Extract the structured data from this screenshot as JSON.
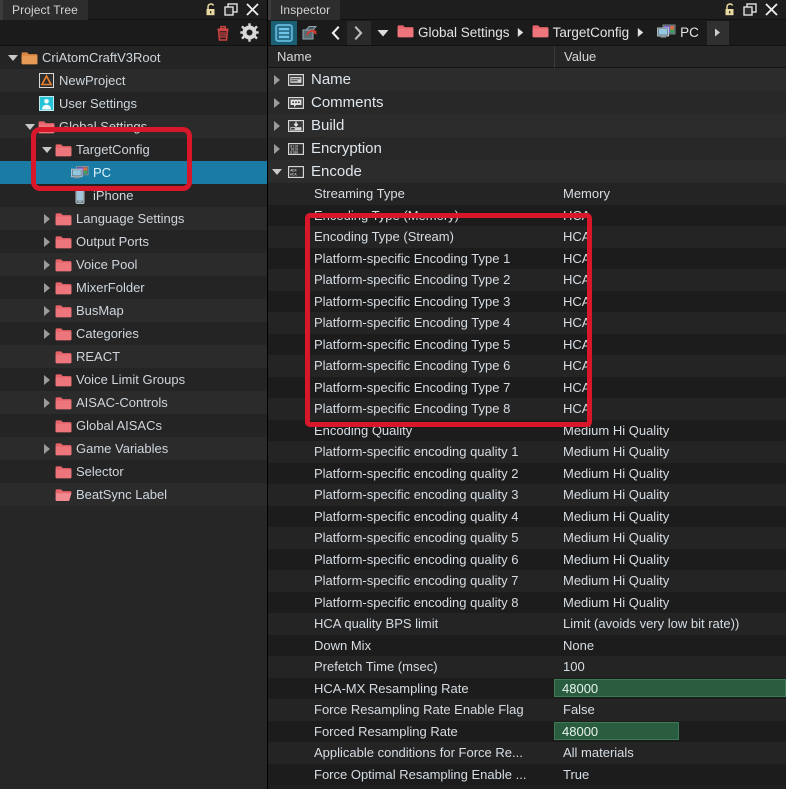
{
  "project_panel": {
    "title": "Project Tree",
    "window_buttons": [
      {
        "name": "unlock-icon",
        "label": "Unlock"
      },
      {
        "name": "restore-icon",
        "label": "Restore"
      },
      {
        "name": "close-icon",
        "label": "Close"
      }
    ],
    "toolbar": [
      {
        "name": "delete-icon",
        "label": "Delete"
      },
      {
        "name": "gear-icon",
        "label": "Settings"
      }
    ],
    "tree": [
      {
        "label": "CriAtomCraftV3Root",
        "depth": 0,
        "caret": "down",
        "icon": "folder-orange-icon",
        "selected": false
      },
      {
        "label": "NewProject",
        "depth": 1,
        "caret": "none",
        "icon": "project-icon",
        "selected": false
      },
      {
        "label": "User Settings",
        "depth": 1,
        "caret": "none",
        "icon": "user-icon",
        "selected": false
      },
      {
        "label": "Global Settings",
        "depth": 1,
        "caret": "down",
        "icon": "folder-red-icon",
        "selected": false
      },
      {
        "label": "TargetConfig",
        "depth": 2,
        "caret": "down",
        "icon": "folder-red-icon",
        "selected": false
      },
      {
        "label": "PC",
        "depth": 3,
        "caret": "none",
        "icon": "pc-icon",
        "selected": true
      },
      {
        "label": "iPhone",
        "depth": 3,
        "caret": "none",
        "icon": "iphone-icon",
        "selected": false
      },
      {
        "label": "Language Settings",
        "depth": 2,
        "caret": "right",
        "icon": "folder-red-icon",
        "selected": false
      },
      {
        "label": "Output Ports",
        "depth": 2,
        "caret": "right",
        "icon": "folder-red-icon",
        "selected": false
      },
      {
        "label": "Voice Pool",
        "depth": 2,
        "caret": "right",
        "icon": "folder-red-icon",
        "selected": false
      },
      {
        "label": "MixerFolder",
        "depth": 2,
        "caret": "right",
        "icon": "folder-red-icon",
        "selected": false
      },
      {
        "label": "BusMap",
        "depth": 2,
        "caret": "right",
        "icon": "folder-red-icon",
        "selected": false
      },
      {
        "label": "Categories",
        "depth": 2,
        "caret": "right",
        "icon": "folder-red-icon",
        "selected": false
      },
      {
        "label": "REACT",
        "depth": 2,
        "caret": "none",
        "icon": "folder-red-icon",
        "selected": false
      },
      {
        "label": "Voice Limit Groups",
        "depth": 2,
        "caret": "right",
        "icon": "folder-red-icon",
        "selected": false
      },
      {
        "label": "AISAC-Controls",
        "depth": 2,
        "caret": "right",
        "icon": "folder-red-icon",
        "selected": false
      },
      {
        "label": "Global AISACs",
        "depth": 2,
        "caret": "none",
        "icon": "folder-red-icon",
        "selected": false
      },
      {
        "label": "Game Variables",
        "depth": 2,
        "caret": "right",
        "icon": "folder-red-icon",
        "selected": false
      },
      {
        "label": "Selector",
        "depth": 2,
        "caret": "none",
        "icon": "folder-red-icon",
        "selected": false
      },
      {
        "label": "BeatSync Label",
        "depth": 2,
        "caret": "none",
        "icon": "folder-red-open-icon",
        "selected": false
      }
    ]
  },
  "inspector_panel": {
    "title": "Inspector",
    "window_buttons": [
      {
        "name": "unlock-icon",
        "label": "Unlock"
      },
      {
        "name": "restore-icon",
        "label": "Restore"
      },
      {
        "name": "close-icon",
        "label": "Close"
      }
    ],
    "toolbar": {
      "list_view_label": "List View",
      "back_to_object_label": "Back To Object",
      "prev_label": "Previous",
      "next_label": "Next",
      "history_label": "History"
    },
    "breadcrumb": [
      {
        "label": "Global Settings",
        "icon": "folder-red-icon"
      },
      {
        "label": "TargetConfig",
        "icon": "folder-red-icon"
      },
      {
        "label": "PC",
        "icon": "pc-icon"
      }
    ],
    "columns": {
      "name": "Name",
      "value": "Value"
    },
    "rows": [
      {
        "type": "group",
        "label": "Name",
        "icon": "name-icon",
        "caret": "right"
      },
      {
        "type": "group",
        "label": "Comments",
        "icon": "comments-icon",
        "caret": "right"
      },
      {
        "type": "group",
        "label": "Build",
        "icon": "build-icon",
        "caret": "right"
      },
      {
        "type": "group",
        "label": "Encryption",
        "icon": "encryption-icon",
        "caret": "right"
      },
      {
        "type": "group",
        "label": "Encode",
        "icon": "encode-icon",
        "caret": "down"
      },
      {
        "type": "prop",
        "label": "Streaming Type",
        "value": "Memory",
        "style": "plain"
      },
      {
        "type": "prop",
        "label": "Encoding Type (Memory)",
        "value": "HCA",
        "style": "plain"
      },
      {
        "type": "prop",
        "label": "Encoding Type (Stream)",
        "value": "HCA",
        "style": "plain"
      },
      {
        "type": "prop",
        "label": "Platform-specific Encoding Type 1",
        "value": "HCA",
        "style": "plain"
      },
      {
        "type": "prop",
        "label": "Platform-specific Encoding Type 2",
        "value": "HCA",
        "style": "plain"
      },
      {
        "type": "prop",
        "label": "Platform-specific Encoding Type 3",
        "value": "HCA",
        "style": "plain"
      },
      {
        "type": "prop",
        "label": "Platform-specific Encoding Type 4",
        "value": "HCA",
        "style": "plain"
      },
      {
        "type": "prop",
        "label": "Platform-specific Encoding Type 5",
        "value": "HCA",
        "style": "plain"
      },
      {
        "type": "prop",
        "label": "Platform-specific Encoding Type 6",
        "value": "HCA",
        "style": "plain"
      },
      {
        "type": "prop",
        "label": "Platform-specific Encoding Type 7",
        "value": "HCA",
        "style": "plain"
      },
      {
        "type": "prop",
        "label": "Platform-specific Encoding Type 8",
        "value": "HCA",
        "style": "plain"
      },
      {
        "type": "prop",
        "label": "Encoding Quality",
        "value": "Medium Hi Quality",
        "style": "plain"
      },
      {
        "type": "prop",
        "label": "Platform-specific encoding quality 1",
        "value": "Medium Hi Quality",
        "style": "plain"
      },
      {
        "type": "prop",
        "label": "Platform-specific encoding quality 2",
        "value": "Medium Hi Quality",
        "style": "plain"
      },
      {
        "type": "prop",
        "label": "Platform-specific encoding quality 3",
        "value": "Medium Hi Quality",
        "style": "plain"
      },
      {
        "type": "prop",
        "label": "Platform-specific encoding quality 4",
        "value": "Medium Hi Quality",
        "style": "plain"
      },
      {
        "type": "prop",
        "label": "Platform-specific encoding quality 5",
        "value": "Medium Hi Quality",
        "style": "plain"
      },
      {
        "type": "prop",
        "label": "Platform-specific encoding quality 6",
        "value": "Medium Hi Quality",
        "style": "plain"
      },
      {
        "type": "prop",
        "label": "Platform-specific encoding quality 7",
        "value": "Medium Hi Quality",
        "style": "plain"
      },
      {
        "type": "prop",
        "label": "Platform-specific encoding quality 8",
        "value": "Medium Hi Quality",
        "style": "plain"
      },
      {
        "type": "prop",
        "label": "HCA quality BPS limit",
        "value": "Limit (avoids very low bit rate))",
        "style": "plain"
      },
      {
        "type": "prop",
        "label": "Down Mix",
        "value": "None",
        "style": "plain"
      },
      {
        "type": "prop",
        "label": "Prefetch Time (msec)",
        "value": "100",
        "style": "plain"
      },
      {
        "type": "prop",
        "label": "HCA-MX Resampling Rate",
        "value": "48000",
        "style": "field-full"
      },
      {
        "type": "prop",
        "label": "Force Resampling Rate Enable Flag",
        "value": "False",
        "style": "plain"
      },
      {
        "type": "prop",
        "label": "Forced Resampling Rate",
        "value": "48000",
        "style": "field-part"
      },
      {
        "type": "prop",
        "label": "Applicable conditions for Force Re...",
        "value": "All materials",
        "style": "plain"
      },
      {
        "type": "prop",
        "label": "Force Optimal Resampling Enable ...",
        "value": "True",
        "style": "plain"
      }
    ]
  },
  "annotations": {
    "tree_highlight_label": "TargetConfig PC iPhone highlight",
    "encoding_highlight_label": "Encoding Type rows highlight",
    "highlight_color": "#d8182a",
    "selection_color": "#1a7ba5",
    "field_color": "#2a5c40"
  }
}
